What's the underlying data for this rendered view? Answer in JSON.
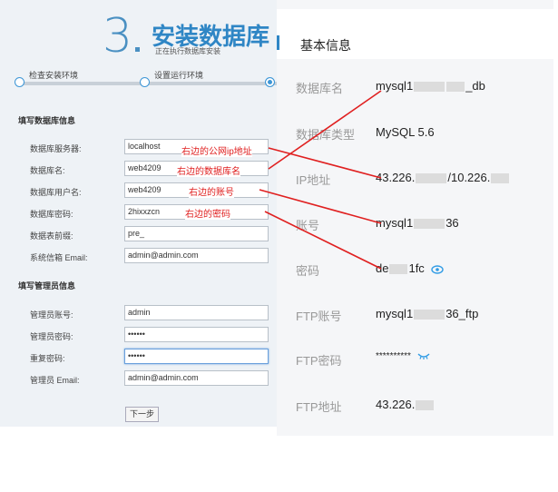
{
  "installer": {
    "step_number": "3",
    "title": "安装数据库",
    "subtitle": "正在执行数据库安装",
    "progress": [
      "检查安装环境",
      "设置运行环境"
    ],
    "db_section_title": "填写数据库信息",
    "db_fields": [
      {
        "label": "数据库服务器:",
        "value": "localhost"
      },
      {
        "label": "数据库名:",
        "value": "web4209"
      },
      {
        "label": "数据库用户名:",
        "value": "web4209"
      },
      {
        "label": "数据库密码:",
        "value": "2hixxzcn"
      },
      {
        "label": "数据表前缀:",
        "value": "pre_"
      },
      {
        "label": "系统信箱 Email:",
        "value": "admin@admin.com"
      }
    ],
    "admin_section_title": "填写管理员信息",
    "admin_fields": [
      {
        "label": "管理员账号:",
        "value": "admin"
      },
      {
        "label": "管理员密码:",
        "value": "••••••"
      },
      {
        "label": "重复密码:",
        "value": "••••••"
      },
      {
        "label": "管理员 Email:",
        "value": "admin@admin.com"
      }
    ],
    "next_button": "下一步"
  },
  "annotations": [
    "右边的公网ip地址",
    "右边的数据库名",
    "右边的账号",
    "右边的密码"
  ],
  "info_panel": {
    "title": "基本信息",
    "rows": [
      {
        "label": "数据库名",
        "value_start": "mysql1",
        "value_end": "_db"
      },
      {
        "label": "数据库类型",
        "value_start": "MySQL 5.6",
        "value_end": ""
      },
      {
        "label": "IP地址",
        "value_start": "43.226.",
        "value_end": "/10.226."
      },
      {
        "label": "账号",
        "value_start": "mysql1",
        "value_end": "36"
      },
      {
        "label": "密码",
        "value_start": "de",
        "value_end": "1fc"
      },
      {
        "label": "FTP账号",
        "value_start": "mysql1",
        "value_end": "36_ftp"
      },
      {
        "label": "FTP密码",
        "value_start": "**********",
        "value_end": ""
      },
      {
        "label": "FTP地址",
        "value_start": "43.226.",
        "value_end": ""
      }
    ]
  },
  "colors": {
    "accent": "#2f86c5",
    "annotation": "#e02020"
  },
  "icons": {
    "password_show": "eye-icon",
    "ftp_password_hidden": "eye-closed-icon"
  }
}
